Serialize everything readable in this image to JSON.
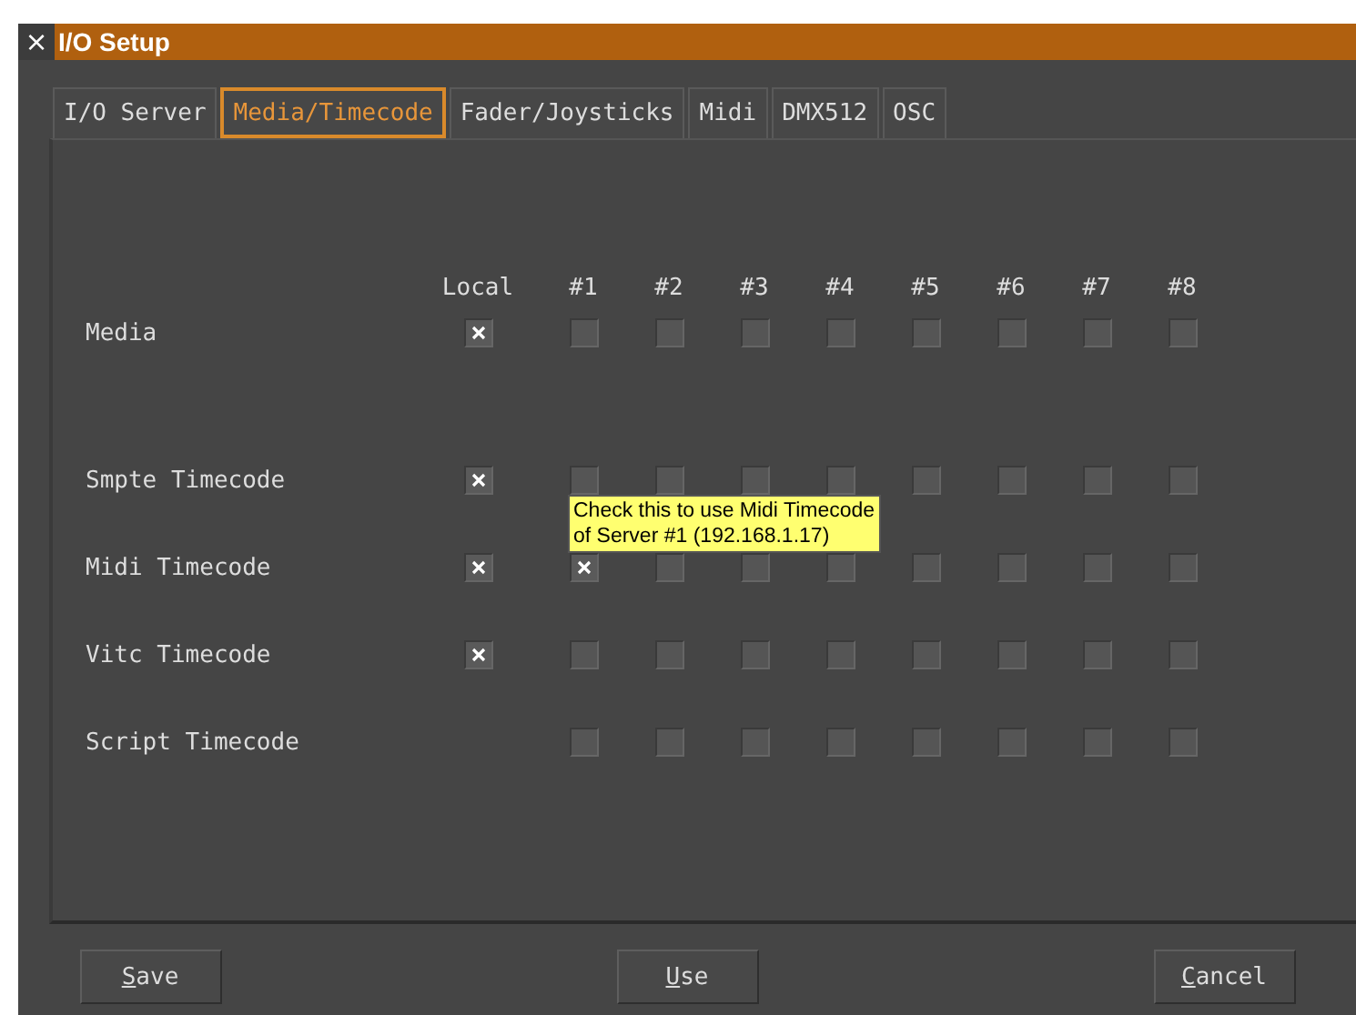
{
  "window": {
    "title": "I/O Setup",
    "close": "×"
  },
  "tabs": [
    {
      "label": "I/O Server",
      "selected": false
    },
    {
      "label": "Media/Timecode",
      "selected": true
    },
    {
      "label": "Fader/Joysticks",
      "selected": false
    },
    {
      "label": "Midi",
      "selected": false
    },
    {
      "label": "DMX512",
      "selected": false
    },
    {
      "label": "OSC",
      "selected": false
    }
  ],
  "grid": {
    "local_heading": "Local",
    "server_headings": [
      "#1",
      "#2",
      "#3",
      "#4",
      "#5",
      "#6",
      "#7",
      "#8"
    ],
    "rows": [
      {
        "label": "Media",
        "local": {
          "checked": true
        },
        "servers": [
          false,
          false,
          false,
          false,
          false,
          false,
          false,
          false
        ]
      },
      {
        "label": "Smpte Timecode",
        "local": {
          "checked": true
        },
        "servers": [
          false,
          false,
          false,
          false,
          false,
          false,
          false,
          false
        ]
      },
      {
        "label": "Midi Timecode",
        "local": {
          "checked": true
        },
        "servers": [
          true,
          false,
          false,
          false,
          false,
          false,
          false,
          false
        ]
      },
      {
        "label": "Vitc Timecode",
        "local": {
          "checked": true
        },
        "servers": [
          false,
          false,
          false,
          false,
          false,
          false,
          false,
          false
        ]
      },
      {
        "label": "Script Timecode",
        "servers": [
          false,
          false,
          false,
          false,
          false,
          false,
          false,
          false
        ]
      }
    ]
  },
  "tooltip": {
    "lines": [
      "Check this to use Midi Timecode",
      "of Server #1 (192.168.1.17)"
    ]
  },
  "buttons": [
    {
      "label": "Save",
      "underline_first": true
    },
    {
      "label": "Use",
      "underline_first": true
    },
    {
      "label": "Cancel",
      "underline_first": true
    }
  ]
}
